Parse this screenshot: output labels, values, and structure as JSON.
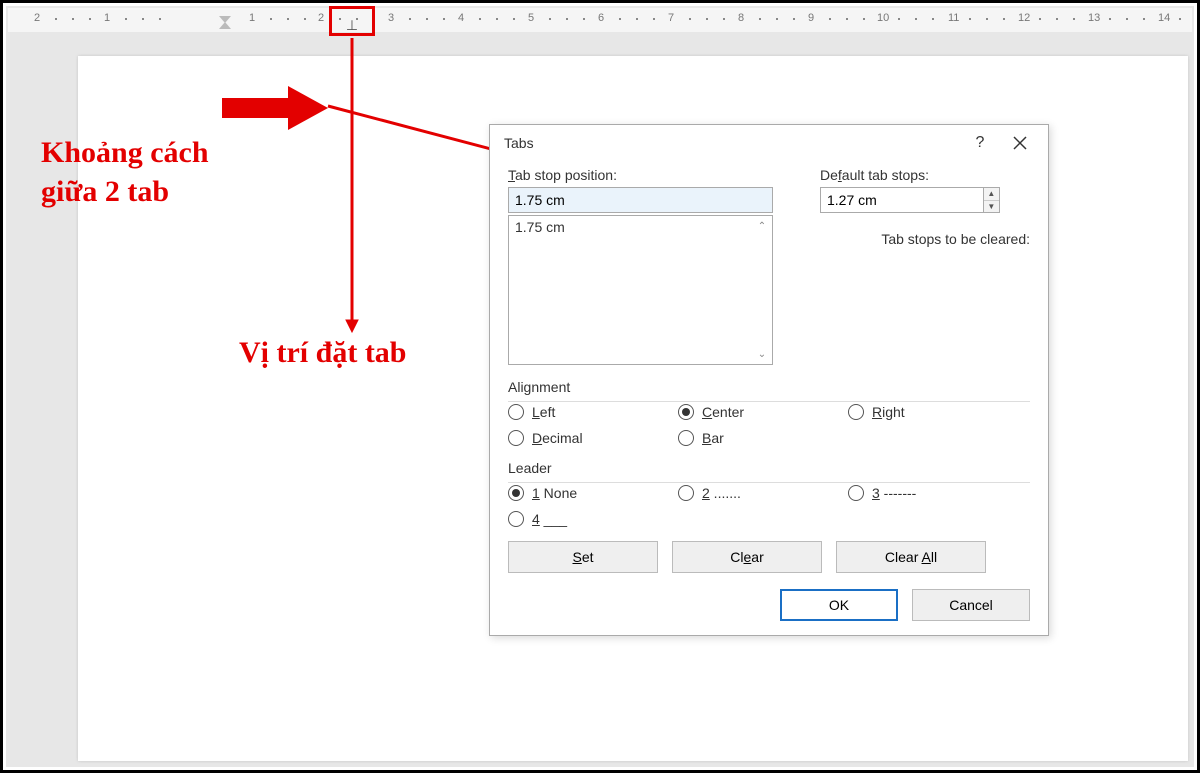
{
  "ruler": {
    "numbers": [
      "2",
      "1",
      "1",
      "2",
      "3",
      "4",
      "5",
      "6",
      "7",
      "8",
      "9",
      "10",
      "11",
      "12",
      "13",
      "14"
    ]
  },
  "annotations": {
    "distance_label": "Khoảng cách\ngiữa 2 tab",
    "position_label": "Vị trí đặt tab"
  },
  "dialog": {
    "title": "Tabs",
    "tab_stop_label": "Tab stop position:",
    "tab_stop_value": "1.75 cm",
    "tab_list": [
      "1.75 cm"
    ],
    "default_stops_label": "Default tab stops:",
    "default_stops_value": "1.27 cm",
    "cleared_label": "Tab stops to be cleared:",
    "alignment": {
      "label": "Alignment",
      "options": {
        "left": "Left",
        "center": "Center",
        "right": "Right",
        "decimal": "Decimal",
        "bar": "Bar"
      },
      "selected": "center"
    },
    "leader": {
      "label": "Leader",
      "options": {
        "none": "1 None",
        "dots": "2 .......",
        "dashes": "3 -------",
        "underline": "4 ___"
      },
      "selected": "none"
    },
    "buttons": {
      "set": "Set",
      "clear": "Clear",
      "clear_all": "Clear All",
      "ok": "OK",
      "cancel": "Cancel"
    }
  }
}
